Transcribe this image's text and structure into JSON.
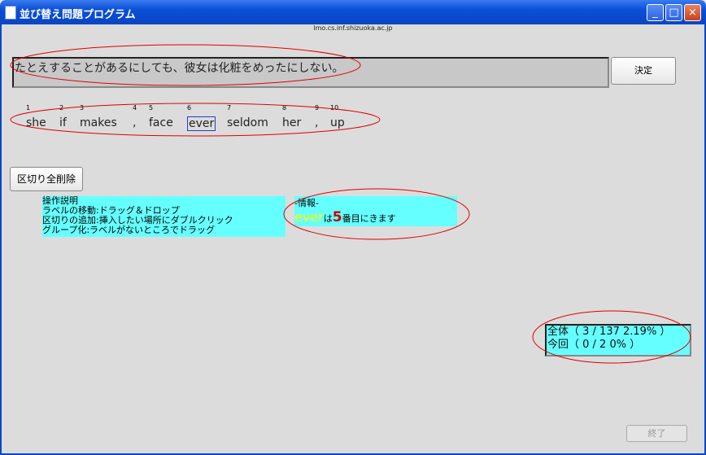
{
  "window": {
    "title": "並び替え問題プログラム",
    "host": "lmo.cs.inf.shizuoka.ac.jp"
  },
  "question": {
    "text": "たとえすることがあるにしても、彼女は化粧をめったにしない。"
  },
  "buttons": {
    "decide": "決定",
    "clear_all": "区切り全削除",
    "finish": "終了"
  },
  "words": [
    {
      "num": "1",
      "text": "she"
    },
    {
      "num": "2",
      "text": "if"
    },
    {
      "num": "3",
      "text": "makes"
    },
    {
      "num": "4",
      "text": ","
    },
    {
      "num": "5",
      "text": "face"
    },
    {
      "num": "6",
      "text": "ever"
    },
    {
      "num": "7",
      "text": "seldom"
    },
    {
      "num": "8",
      "text": "her"
    },
    {
      "num": "9",
      "text": ","
    },
    {
      "num": "10",
      "text": "up"
    }
  ],
  "instructions": {
    "title": "操作説明",
    "lines": [
      "ラベルの移動:ドラッグ＆ドロップ",
      "区切りの追加:挿入したい場所にダブルクリック",
      "グループ化:ラベルがないところでドラッグ"
    ]
  },
  "info": {
    "header": "-情報-",
    "word": "ever",
    "particle": "は",
    "position": "5",
    "suffix": "番目にきます"
  },
  "stats": {
    "total": "全体（ 3 / 137 2.19% ）",
    "current": "今回（ 0 / 2 0% ）"
  },
  "colors": {
    "panel": "#66ffff",
    "highlight_word": "#ffff00",
    "highlight_num": "#cc0000",
    "annotation": "#e00000"
  }
}
